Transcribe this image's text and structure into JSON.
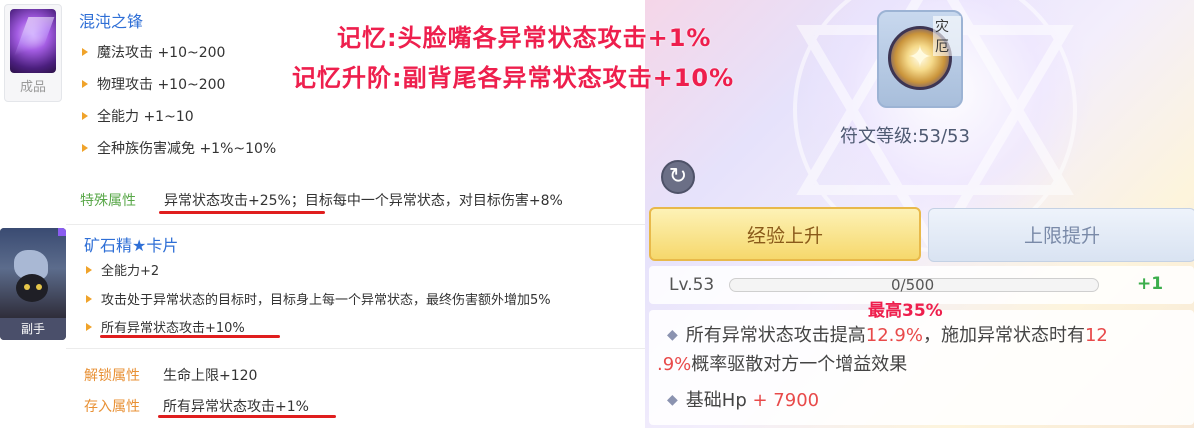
{
  "overlay": {
    "line1": "记忆:头脸嘴各异常状态攻击+1%",
    "line2": "记忆升阶:副背尾各异常状态攻击+10%",
    "max_note": "最高35%"
  },
  "item_weapon": {
    "name": "混沌之锋",
    "thumb_caption": "成品",
    "attributes": [
      "魔法攻击 +10~200",
      "物理攻击 +10~200",
      "全能力 +1~10",
      "全种族伤害减免 +1%~10%"
    ],
    "special_label": "特殊属性",
    "special_text_a": "异常状态攻击+25%",
    "special_text_b": "；目标每中一个异常状态，对目标伤害+8%"
  },
  "item_card": {
    "name": "矿石精★卡片",
    "thumb_caption": "副手",
    "attributes": [
      "全能力+2",
      "攻击处于异常状态的目标时，目标身上每一个异常状态，最终伤害额外增加5%",
      "所有异常状态攻击+10%"
    ],
    "unlock_label": "解锁属性",
    "unlock_text": "生命上限+120",
    "deposit_label": "存入属性",
    "deposit_text": "所有异常状态攻击+1%"
  },
  "rune_panel": {
    "rune_name": "灾厄",
    "rune_level": "符文等级:53/53",
    "btn_exp": "经验上升",
    "btn_cap": "上限提升",
    "level": "Lv.53",
    "xp": "0/500",
    "xp_fraction": 0,
    "plus": "+1",
    "effect1_a": "所有异常状态攻击提高",
    "effect1_val": "12.9%",
    "effect1_b": "，施加异常状态时有",
    "effect1_c": "12",
    "effect1_d": ".9%",
    "effect1_e": "概率驱散对方一个增益效果",
    "effect2_a": "基础Hp",
    "effect2_val": "+ 7900"
  }
}
